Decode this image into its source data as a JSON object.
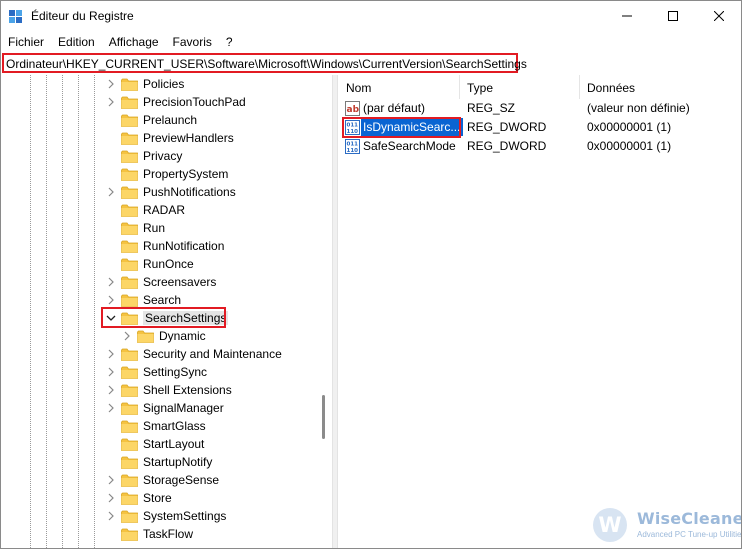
{
  "window": {
    "title": "Éditeur du Registre"
  },
  "menu": [
    "Fichier",
    "Edition",
    "Affichage",
    "Favoris",
    "?"
  ],
  "address": "Ordinateur\\HKEY_CURRENT_USER\\Software\\Microsoft\\Windows\\CurrentVersion\\SearchSettings",
  "tree": {
    "items": [
      {
        "label": "Policies",
        "expandable": true
      },
      {
        "label": "PrecisionTouchPad",
        "expandable": true
      },
      {
        "label": "Prelaunch",
        "expandable": false
      },
      {
        "label": "PreviewHandlers",
        "expandable": false
      },
      {
        "label": "Privacy",
        "expandable": false
      },
      {
        "label": "PropertySystem",
        "expandable": false
      },
      {
        "label": "PushNotifications",
        "expandable": true
      },
      {
        "label": "RADAR",
        "expandable": false
      },
      {
        "label": "Run",
        "expandable": false
      },
      {
        "label": "RunNotification",
        "expandable": false
      },
      {
        "label": "RunOnce",
        "expandable": false
      },
      {
        "label": "Screensavers",
        "expandable": true
      },
      {
        "label": "Search",
        "expandable": true
      },
      {
        "label": "SearchSettings",
        "expandable": true,
        "expanded": true,
        "selected": true
      },
      {
        "label": "Dynamic",
        "expandable": true,
        "child": true
      },
      {
        "label": "Security and Maintenance",
        "expandable": true
      },
      {
        "label": "SettingSync",
        "expandable": true
      },
      {
        "label": "Shell Extensions",
        "expandable": true
      },
      {
        "label": "SignalManager",
        "expandable": true
      },
      {
        "label": "SmartGlass",
        "expandable": false
      },
      {
        "label": "StartLayout",
        "expandable": false
      },
      {
        "label": "StartupNotify",
        "expandable": false
      },
      {
        "label": "StorageSense",
        "expandable": true
      },
      {
        "label": "Store",
        "expandable": true
      },
      {
        "label": "SystemSettings",
        "expandable": true
      },
      {
        "label": "TaskFlow",
        "expandable": false
      }
    ]
  },
  "values": {
    "headers": {
      "name": "Nom",
      "type": "Type",
      "data": "Données"
    },
    "rows": [
      {
        "name": "(par défaut)",
        "type": "REG_SZ",
        "data": "(valeur non définie)",
        "icon": "string-value-icon"
      },
      {
        "name": "IsDynamicSearc...",
        "type": "REG_DWORD",
        "data": "0x00000001 (1)",
        "icon": "binary-value-icon",
        "selected": true
      },
      {
        "name": "SafeSearchMode",
        "type": "REG_DWORD",
        "data": "0x00000001 (1)",
        "icon": "binary-value-icon"
      }
    ]
  },
  "watermark": {
    "letter": "W",
    "name": "WiseCleaner",
    "tagline": "Advanced PC Tune-up Utilities"
  },
  "colors": {
    "highlight_border": "#e21b23",
    "selection": "#0a64d2",
    "folder": "#f5c342"
  }
}
